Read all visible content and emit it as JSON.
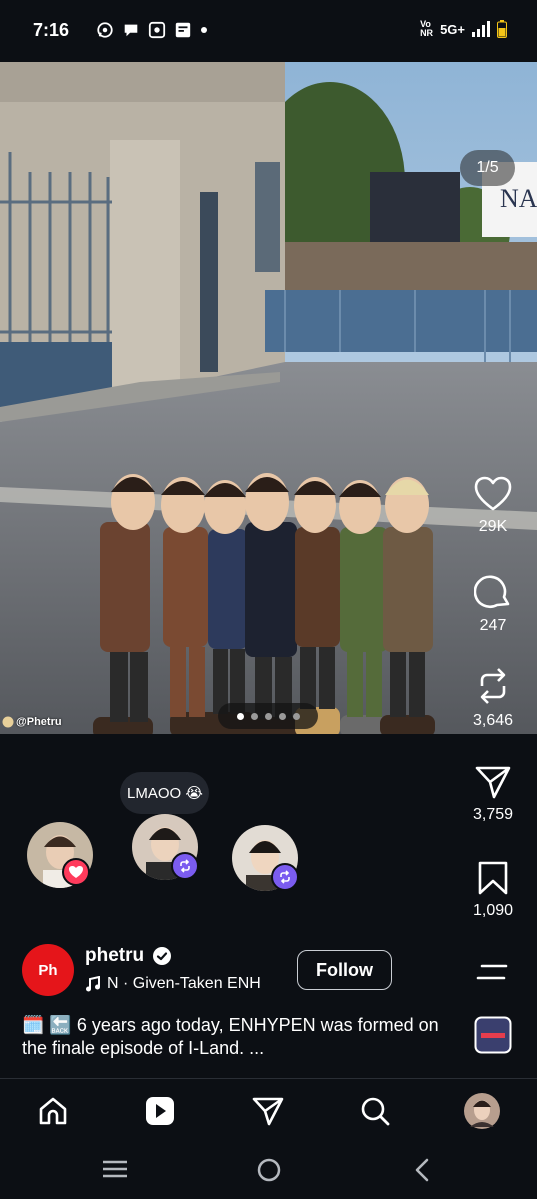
{
  "status_bar": {
    "time": "7:16",
    "volte": "Vo NR",
    "network": "5G+",
    "notification_icons": [
      "whatsapp-icon",
      "chat-icon",
      "app-icon",
      "app-icon",
      "dot"
    ]
  },
  "post": {
    "slide_counter": "1/5",
    "watermark": "@Phetru",
    "slide_count": 5,
    "active_slide": 1,
    "likes": "29K",
    "comments": "247",
    "reposts": "3,646",
    "shares": "3,759",
    "saves": "1,090",
    "reaction_note": "LMAOO 😭",
    "author": {
      "avatar_text": "Ph",
      "username": "phetru",
      "verified": true,
      "music": "N · Given-Taken    ENH",
      "follow_label": "Follow"
    },
    "caption": "🗓️ 🔙 6 years ago today, ENHYPEN was formed on the finale episode of I-Land. ..."
  },
  "bottom_nav": [
    "home-icon",
    "reels-icon",
    "send-icon",
    "search-icon",
    "profile-avatar"
  ],
  "colors": {
    "background": "#0c0f14",
    "verified": "#3897f0",
    "repost_badge": "#7b5cf0",
    "heart_badge": "#ff3b5c",
    "author_avatar": "#e5151a"
  }
}
